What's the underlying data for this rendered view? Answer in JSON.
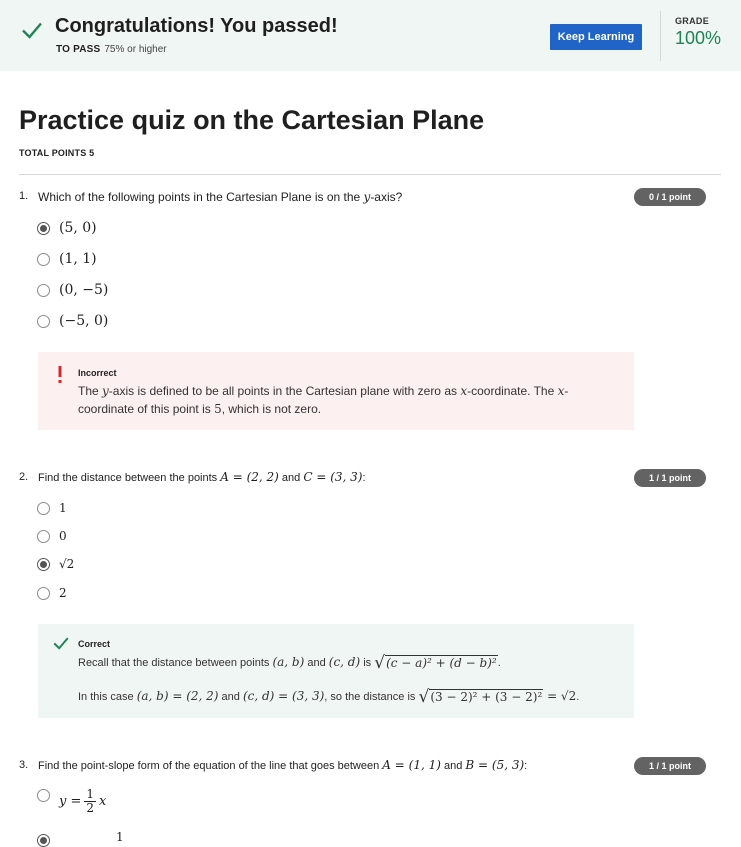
{
  "banner": {
    "title": "Congratulations! You passed!",
    "to_pass_label": "TO PASS",
    "to_pass_value": "75% or higher",
    "keep_learning": "Keep Learning",
    "grade_label": "GRADE",
    "grade_value": "100%"
  },
  "quiz": {
    "title": "Practice quiz on the Cartesian Plane",
    "total_points": "TOTAL POINTS 5"
  },
  "q1": {
    "number": "1.",
    "text_before": "Which of the following points in the Cartesian Plane is on the ",
    "var": "y",
    "text_after": "-axis?",
    "points": "0 / 1 point",
    "options": [
      "(5, 0)",
      "(1, 1)",
      "(0, −5)",
      "(−5, 0)"
    ],
    "feedback_title": "Incorrect",
    "feedback_line1_a": "The ",
    "feedback_line1_var": "y",
    "feedback_line1_b": "-axis is defined to be all points in the Cartesian plane with zero as ",
    "feedback_line1_var2": "x",
    "feedback_line1_c": "-coordinate. The ",
    "feedback_line1_var3": "x",
    "feedback_line1_d": "-",
    "feedback_line2_a": "coordinate of this point is ",
    "feedback_line2_num": "5",
    "feedback_line2_b": ", which is not zero."
  },
  "q2": {
    "number": "2.",
    "text_a": "Find the distance between the points ",
    "point_a": "A = (2, 2)",
    "text_b": " and ",
    "point_c": "C = (3, 3)",
    "text_c": ":",
    "points": "1 / 1 point",
    "options": [
      "1",
      "0",
      "√2",
      "2"
    ],
    "feedback_title": "Correct",
    "line1_a": "Recall that the distance between points ",
    "line1_p1": "(a, b)",
    "line1_b": " and ",
    "line1_p2": "(c, d)",
    "line1_c": " is ",
    "line1_formula": "(c − a)² + (d − b)²",
    "line1_end": ".",
    "line2_a": "In this case ",
    "line2_eq1": "(a, b) = (2, 2)",
    "line2_b": " and ",
    "line2_eq2": "(c, d) = (3, 3)",
    "line2_c": ", so the distance is ",
    "line2_formula": "(3 − 2)² + (3 − 2)²",
    "line2_result": " = √2",
    "line2_end": "."
  },
  "q3": {
    "number": "3.",
    "text_a": "Find the point-slope form of the equation of the line that goes between ",
    "point_a": "A = (1, 1)",
    "text_b": " and ",
    "point_b": "B = (5, 3)",
    "text_c": ":",
    "points": "1 / 1 point",
    "option1_lhs": "y = ",
    "option1_num": "1",
    "option1_den": "2",
    "option1_var": "x",
    "option2_num": "1"
  },
  "colors": {
    "accent": "#1f64c6",
    "success": "#1f8354",
    "error": "#d12a2a",
    "pill": "#636363"
  }
}
